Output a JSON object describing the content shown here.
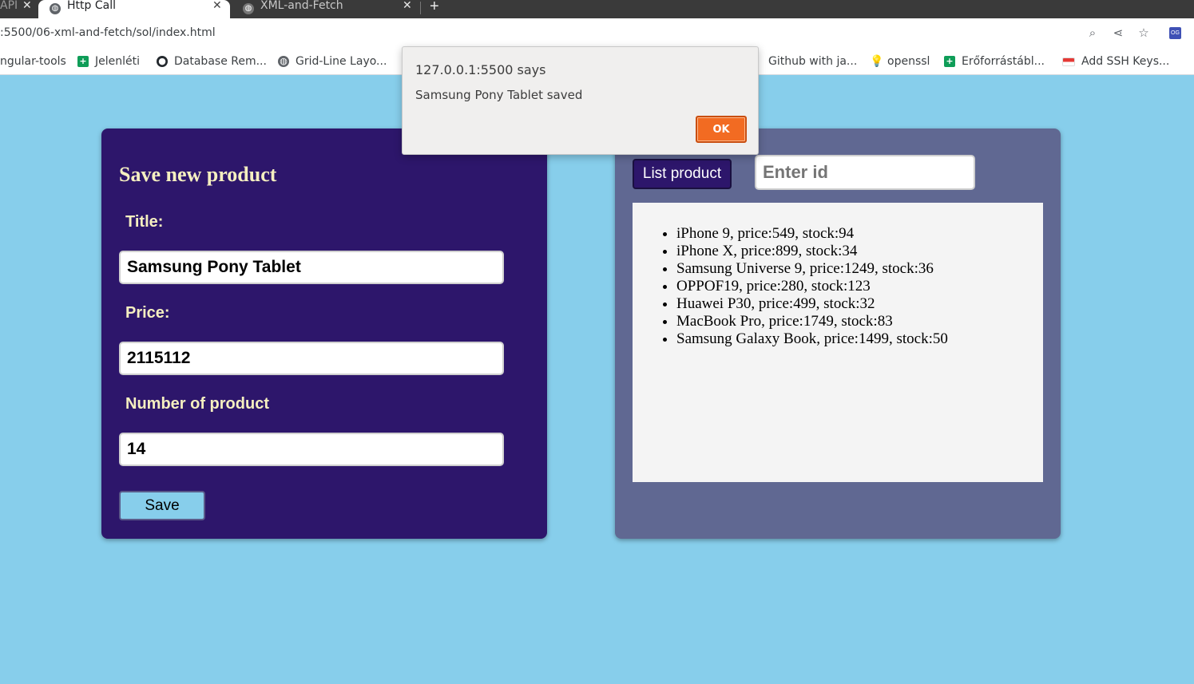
{
  "browser": {
    "tabs": [
      {
        "title": "API",
        "state": "partial"
      },
      {
        "title": "Http Call",
        "state": "active"
      },
      {
        "title": "XML-and-Fetch",
        "state": "inactive"
      }
    ],
    "new_tab": "+",
    "url": ":5500/06-xml-and-fetch/sol/index.html",
    "profile_badge": "OG",
    "bookmarks": [
      {
        "label": "ngular-tools",
        "icon": "none"
      },
      {
        "label": "Jelenléti",
        "icon": "sheets-icon"
      },
      {
        "label": "Database Rem...",
        "icon": "github-icon"
      },
      {
        "label": "Grid-Line Layo...",
        "icon": "globe-icon"
      },
      {
        "label": "Github with ja...",
        "icon": "github-icon"
      },
      {
        "label": "openssl",
        "icon": "lightbulb-icon"
      },
      {
        "label": "Erőforrástábl...",
        "icon": "sheets-icon"
      },
      {
        "label": "Add SSH Keys...",
        "icon": "flag-icon"
      }
    ]
  },
  "form": {
    "title": "Save new product",
    "title_label": "Title:",
    "title_value": "Samsung Pony Tablet",
    "price_label": "Price:",
    "price_value": "2115112",
    "count_label": "Number of product",
    "count_value": "14",
    "save_label": "Save"
  },
  "list": {
    "button_label": "List product",
    "id_placeholder": "Enter id",
    "items": [
      "iPhone 9, price:549, stock:94",
      "iPhone X, price:899, stock:34",
      "Samsung Universe 9, price:1249, stock:36",
      "OPPOF19, price:280, stock:123",
      "Huawei P30, price:499, stock:32",
      "MacBook Pro, price:1749, stock:83",
      "Samsung Galaxy Book, price:1499, stock:50"
    ]
  },
  "dialog": {
    "origin": "127.0.0.1:5500 says",
    "message": "Samsung Pony Tablet saved",
    "ok_label": "OK"
  },
  "colors": {
    "page_background": "#87ceeb",
    "form_card": "#2d166b",
    "list_card": "#606892",
    "label_text": "#f5efc0",
    "ok_button": "#f26b22"
  }
}
